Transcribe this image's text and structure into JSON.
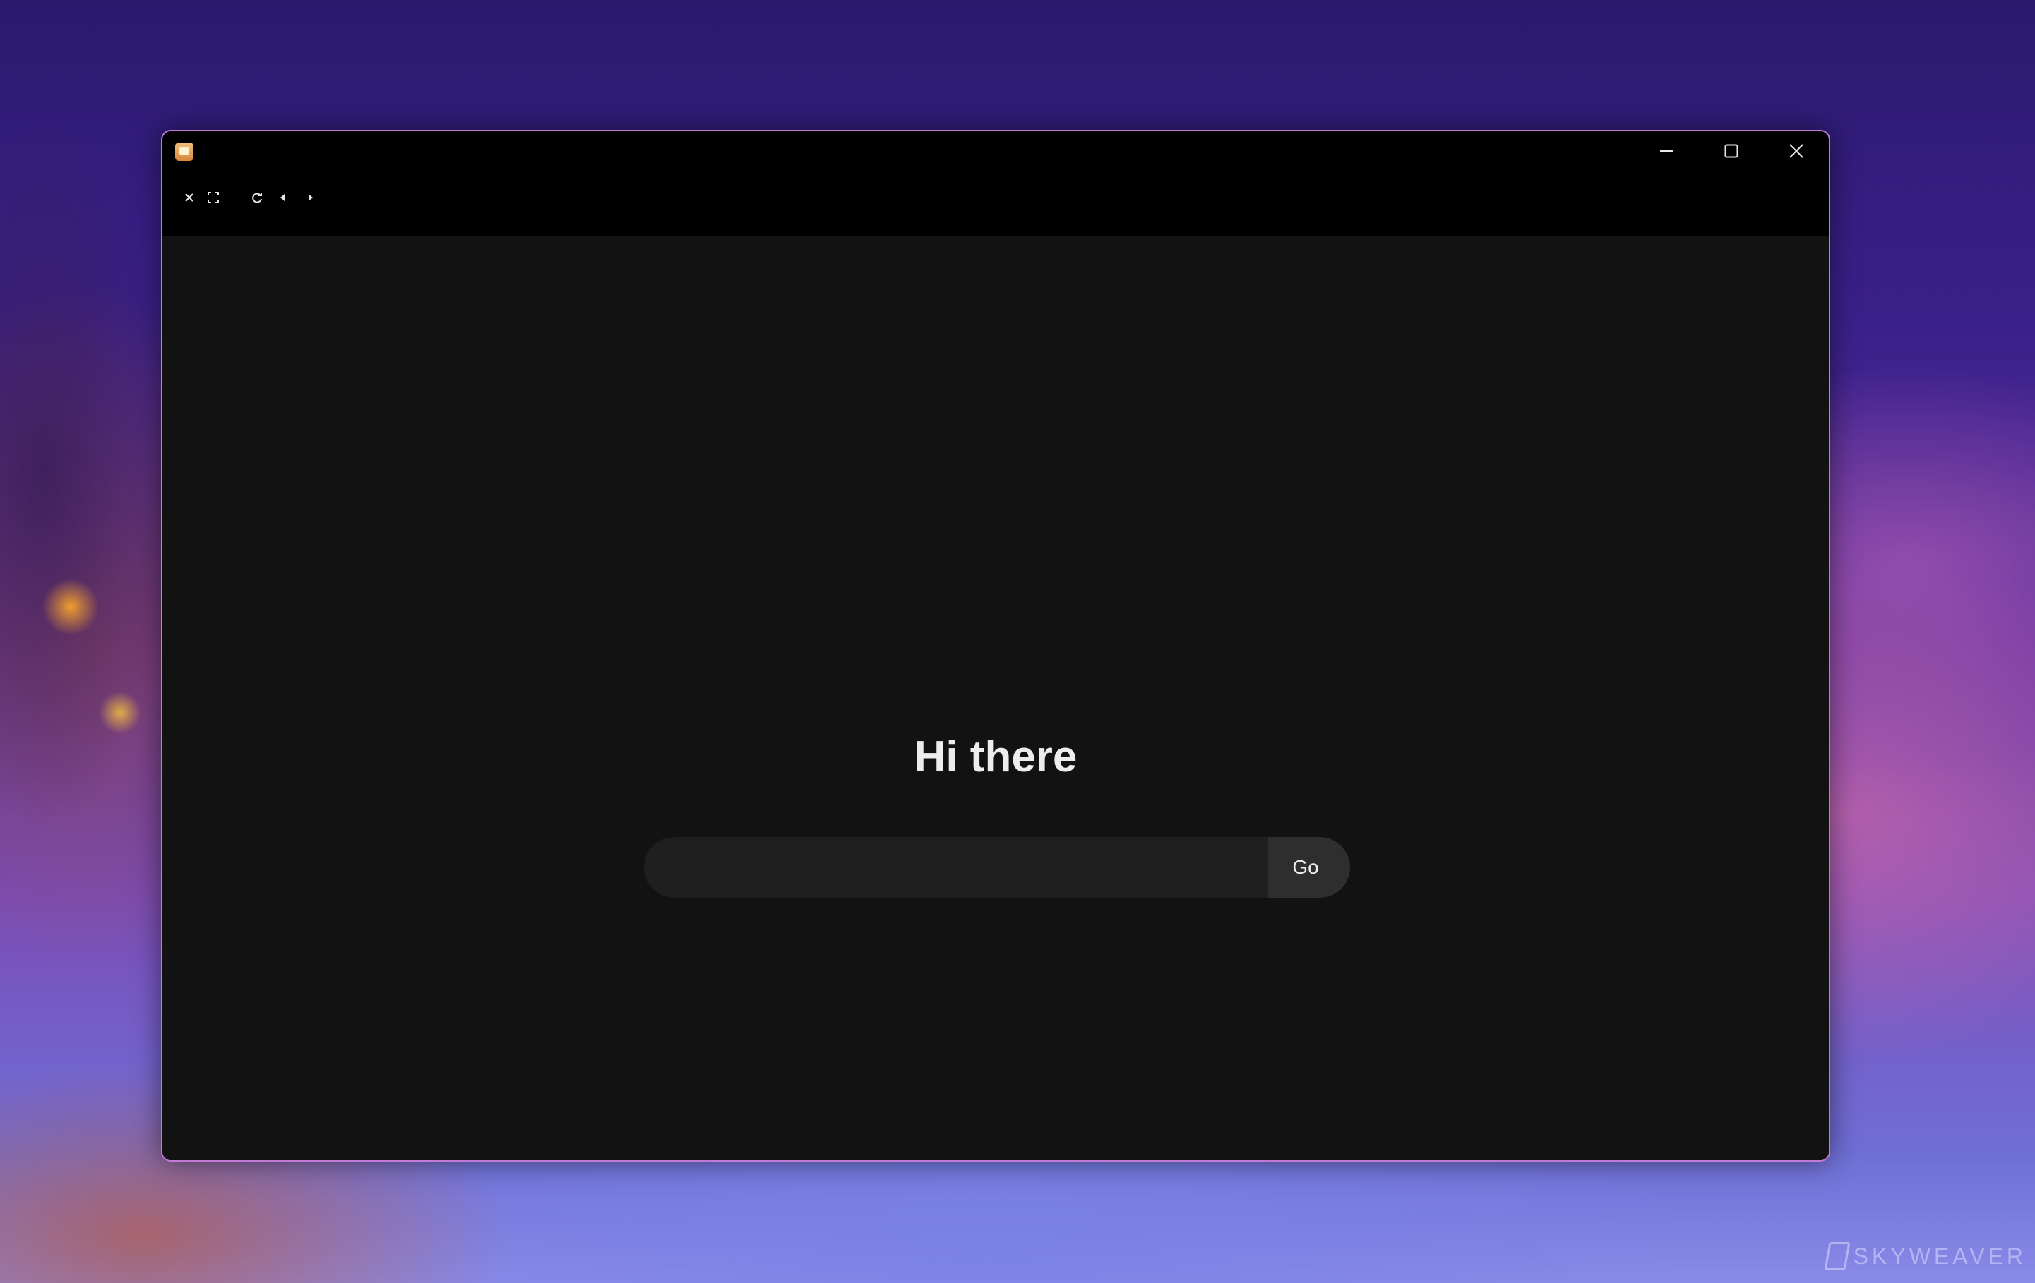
{
  "wallpaper": {
    "watermark": "SKYWEAVER"
  },
  "window": {
    "border_color": "#c27ad6",
    "titlebar": {
      "controls": [
        {
          "name": "minimize",
          "icon": "minimize-icon"
        },
        {
          "name": "maximize",
          "icon": "maximize-icon"
        },
        {
          "name": "close",
          "icon": "close-icon"
        }
      ]
    },
    "toolbar": {
      "buttons": [
        {
          "name": "close-view",
          "icon": "x-icon"
        },
        {
          "name": "fullscreen",
          "icon": "fullscreen-icon"
        },
        {
          "name": "reload",
          "icon": "reload-icon"
        },
        {
          "name": "back",
          "icon": "caret-left-icon"
        },
        {
          "name": "forward",
          "icon": "caret-right-icon"
        }
      ]
    }
  },
  "main": {
    "greeting": "Hi there",
    "search": {
      "value": "",
      "placeholder": "",
      "button_label": "Go"
    }
  }
}
